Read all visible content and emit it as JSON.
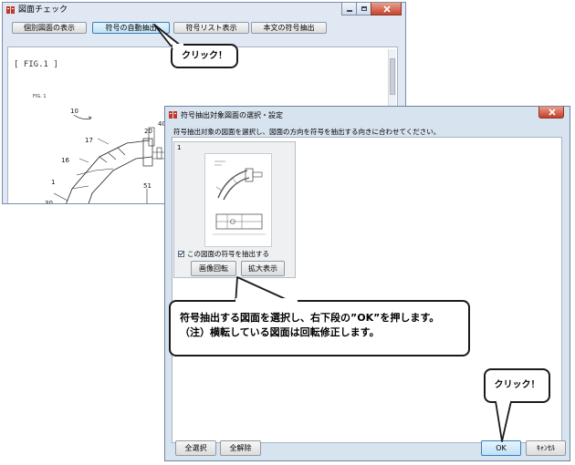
{
  "back_window": {
    "title": "図面チェック",
    "buttons": [
      "個別図面の表示",
      "符号の自動抽出",
      "符号リスト表示",
      "本文の符号抽出"
    ],
    "fig_heading": "[ FIG.1 ]",
    "fig_small": "FIG. 1",
    "drawing_labels": [
      "10",
      "40",
      "20",
      "17",
      "16",
      "1",
      "30",
      "51"
    ]
  },
  "callouts": {
    "top_click": "クリック！",
    "bottom_click": "クリック！",
    "instruction_line1": "符号抽出する図面を選択し、右下段の”OK”を押します。",
    "instruction_line2": "（注）横転している図面は回転修正します。"
  },
  "dialog": {
    "title": "符号抽出対象図面の選択・設定",
    "instruction": "符号抽出対象の図面を選択し、図面の方向を符号を抽出する向きに合わせてください。",
    "card_number": "1",
    "checkbox_label": "この図面の符号を抽出する",
    "rotate_button": "画像回転",
    "zoom_button": "拡大表示",
    "select_all": "全選択",
    "deselect_all": "全解除",
    "ok": "OK",
    "cancel": "ｷｬﾝｾﾙ"
  },
  "colors": {
    "accent": "#3c7fb1",
    "close_red": "#c33f27"
  }
}
